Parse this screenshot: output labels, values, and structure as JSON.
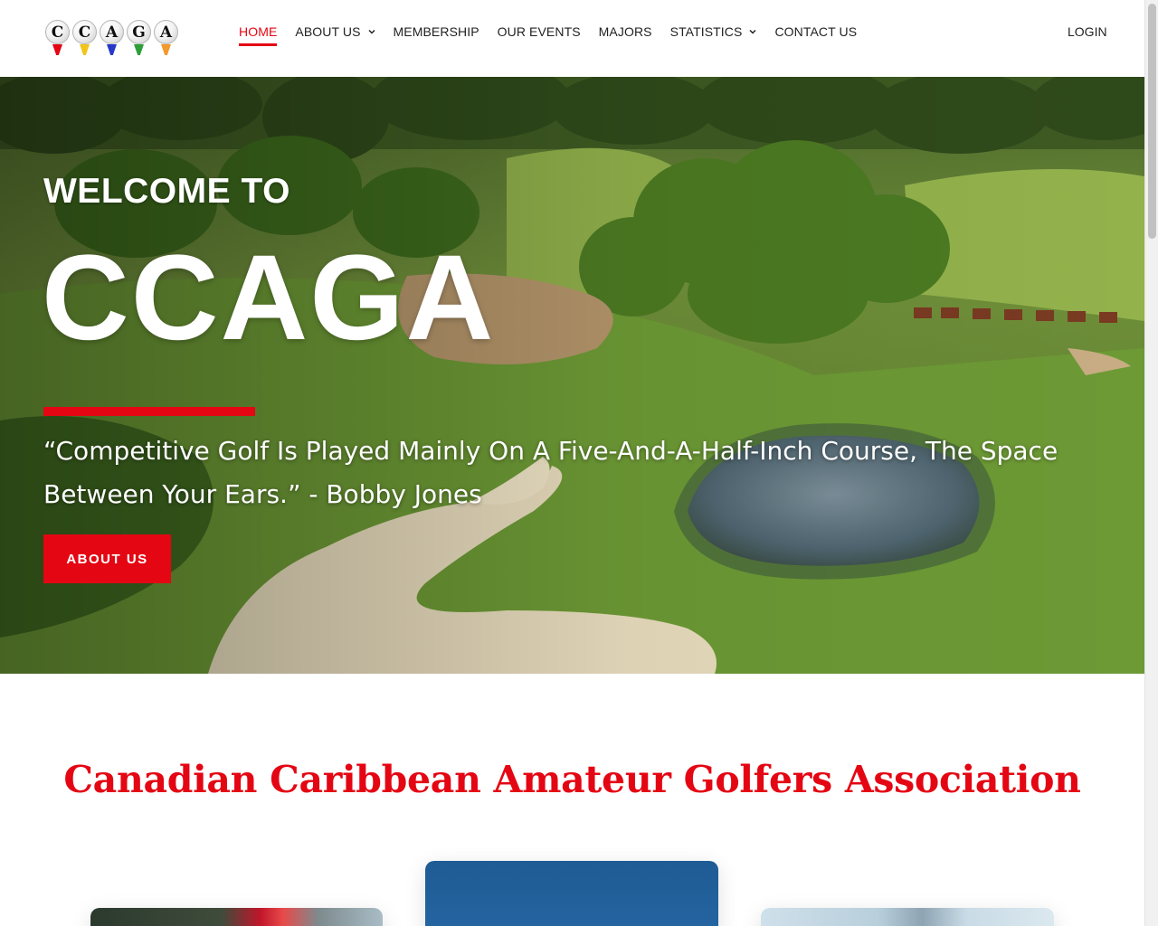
{
  "logo": {
    "letters": [
      "C",
      "C",
      "A",
      "G",
      "A"
    ],
    "tee_colors": [
      "#e40613",
      "#f0c419",
      "#2638c9",
      "#2e9e3a",
      "#f29a2e"
    ]
  },
  "nav": {
    "items": [
      {
        "label": "HOME",
        "active": true,
        "dropdown": false
      },
      {
        "label": "ABOUT US",
        "active": false,
        "dropdown": true
      },
      {
        "label": "MEMBERSHIP",
        "active": false,
        "dropdown": false
      },
      {
        "label": "OUR EVENTS",
        "active": false,
        "dropdown": false
      },
      {
        "label": "MAJORS",
        "active": false,
        "dropdown": false
      },
      {
        "label": "STATISTICS",
        "active": false,
        "dropdown": true
      },
      {
        "label": "CONTACT US",
        "active": false,
        "dropdown": false
      }
    ],
    "login_label": "LOGIN"
  },
  "hero": {
    "welcome": "WELCOME TO",
    "brand": "CCAGA",
    "quote": "“Competitive Golf Is Played Mainly On A Five-And-A-Half-Inch Course, The Space Between Your Ears.” - Bobby Jones",
    "button_label": "ABOUT US"
  },
  "section": {
    "title": "Canadian Caribbean Amateur Golfers Association"
  },
  "colors": {
    "accent": "#e40613",
    "text": "#222222",
    "background": "#ffffff"
  }
}
